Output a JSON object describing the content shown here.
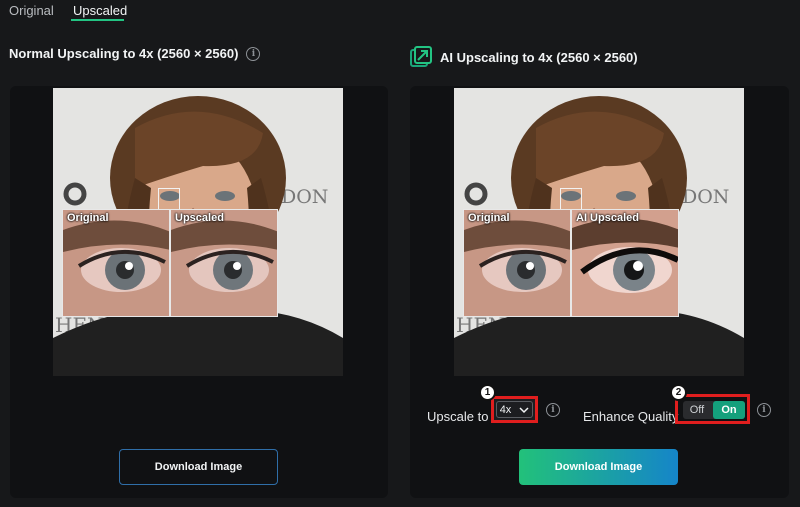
{
  "tabs": [
    {
      "label": "Original",
      "active": false
    },
    {
      "label": "Upscaled",
      "active": true
    }
  ],
  "left_panel": {
    "title": "Normal Upscaling to 4x (2560 × 2560)",
    "inset_original_label": "Original",
    "inset_upscaled_label": "Upscaled",
    "download_label": "Download Image"
  },
  "right_panel": {
    "title": "AI Upscaling to 4x (2560 × 2560)",
    "icon": "ai-upscale-icon",
    "inset_original_label": "Original",
    "inset_upscaled_label": "AI Upscaled",
    "upscale_label": "Upscale to",
    "upscale_value": "4x",
    "enhance_label": "Enhance Quality",
    "toggle_off": "Off",
    "toggle_on": "On",
    "download_label": "Download Image"
  },
  "annotations": {
    "badge1": "1",
    "badge2": "2"
  },
  "colors": {
    "accent": "#23c483",
    "highlight": "#e01e1e",
    "button_gradient": [
      "#22c17a",
      "#1585c9"
    ]
  }
}
